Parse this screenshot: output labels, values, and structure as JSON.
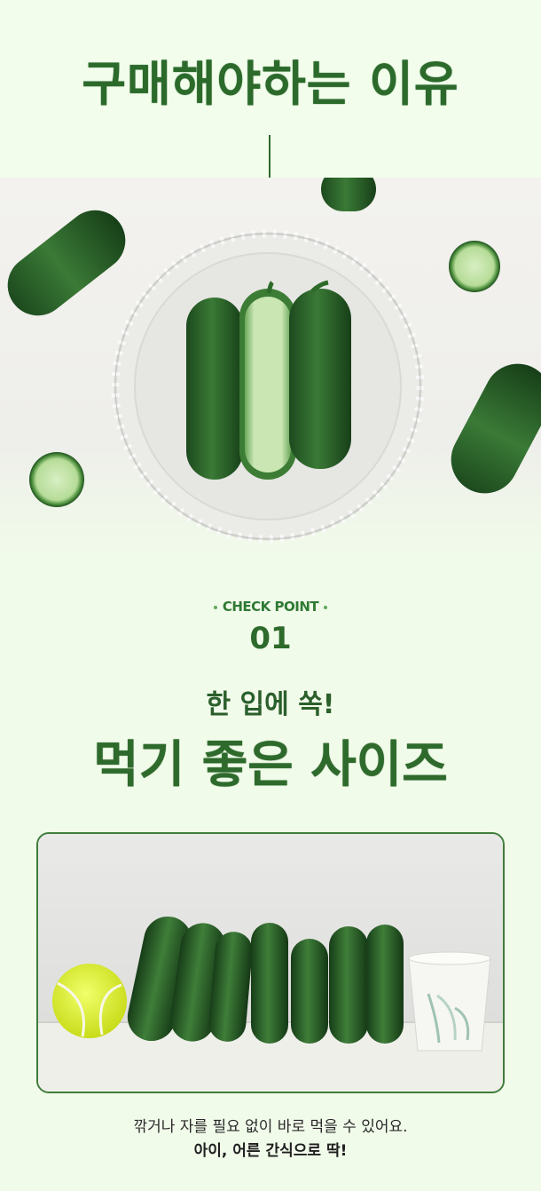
{
  "header": {
    "title": "구매해야하는 이유"
  },
  "checkpoint": {
    "label": "CHECK POINT",
    "number": "01",
    "subheading": "한 입에 쏙!",
    "heading": "먹기 좋은 사이즈"
  },
  "caption": {
    "line1": "깎거나 자를 필요 없이 바로 먹을 수 있어요.",
    "line2": "아이, 어른 간식으로 딱!"
  },
  "colors": {
    "brand_green": "#2c6a2b",
    "background": "#f1fbea"
  }
}
